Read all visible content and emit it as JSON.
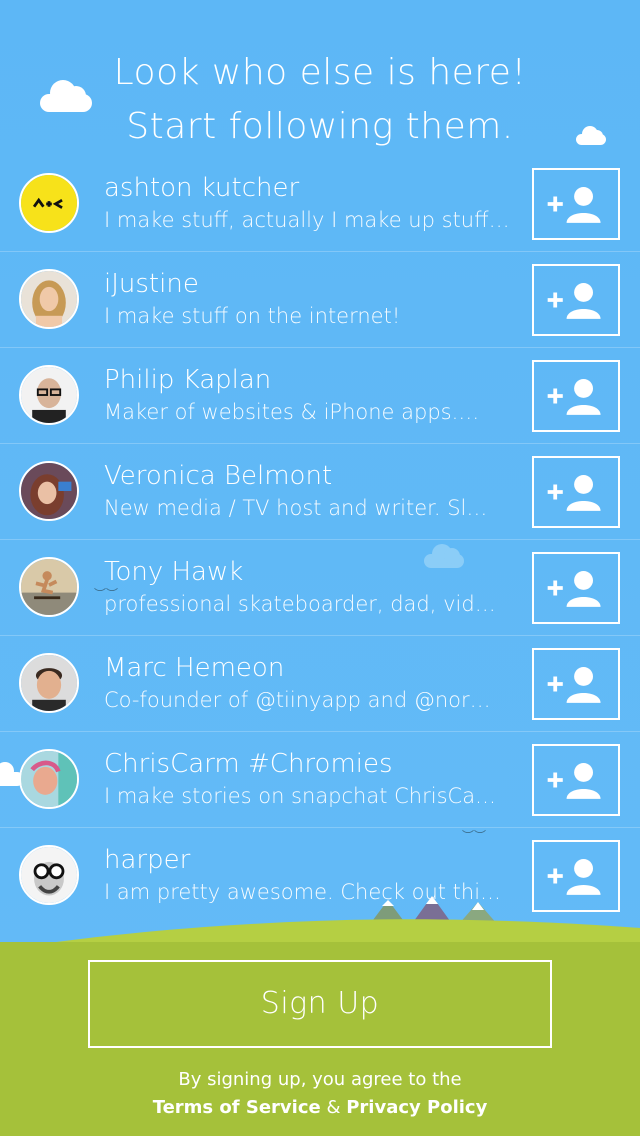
{
  "header": {
    "line1": "Look who else is here!",
    "line2": "Start following them."
  },
  "users": [
    {
      "name": "ashton kutcher",
      "bio": "I make stuff, actually I make up stuff…",
      "avatar_icon": "ashton-kutcher-logo-avatar"
    },
    {
      "name": "iJustine",
      "bio": "I make stuff on the internet!",
      "avatar_icon": "ijustine-avatar"
    },
    {
      "name": "Philip Kaplan",
      "bio": "Maker of websites & iPhone apps.…",
      "avatar_icon": "philip-kaplan-avatar"
    },
    {
      "name": "Veronica Belmont",
      "bio": "New media / TV host and writer. Sl…",
      "avatar_icon": "veronica-belmont-avatar"
    },
    {
      "name": "Tony Hawk",
      "bio": "professional skateboarder, dad, vid…",
      "avatar_icon": "tony-hawk-avatar"
    },
    {
      "name": "Marc Hemeon",
      "bio": "Co-founder of @tiinyapp and @nor…",
      "avatar_icon": "marc-hemeon-avatar"
    },
    {
      "name": "ChrisCarm #Chromies",
      "bio": "I make stories on snapchat ChrisCa…",
      "avatar_icon": "chriscarm-avatar"
    },
    {
      "name": "harper",
      "bio": "I am pretty awesome. Check out thi…",
      "avatar_icon": "harper-avatar"
    }
  ],
  "follow_icon": "add-user-icon",
  "signup": {
    "label": "Sign Up"
  },
  "legal": {
    "prefix": "By signing up, you agree to the",
    "terms": "Terms of Service",
    "amp": "&",
    "privacy": "Privacy Policy"
  },
  "colors": {
    "sky": "#5fb8f5",
    "ground": "#a5c13a",
    "text": "#ffffff"
  }
}
